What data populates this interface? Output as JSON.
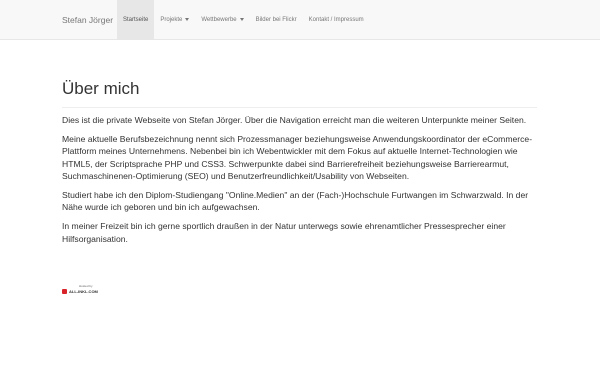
{
  "navbar": {
    "brand": "Stefan Jörger",
    "items": [
      {
        "label": "Startseite",
        "active": true,
        "dropdown": false
      },
      {
        "label": "Projekte",
        "active": false,
        "dropdown": true
      },
      {
        "label": "Wettbewerbe",
        "active": false,
        "dropdown": true
      },
      {
        "label": "Bilder bei Flickr",
        "active": false,
        "dropdown": false
      },
      {
        "label": "Kontakt / Impressum",
        "active": false,
        "dropdown": false
      }
    ]
  },
  "main": {
    "title": "Über mich",
    "paragraphs": [
      "Dies ist die private Webseite von Stefan Jörger. Über die Navigation erreicht man die weiteren Unterpunkte meiner Seiten.",
      "Meine aktuelle Berufsbezeichnung nennt sich Prozessmanager beziehungsweise Anwendungskoordinator der eCommerce-Plattform meines Unternehmens. Nebenbei bin ich Webentwickler mit dem Fokus auf aktuelle Internet-Technologien wie HTML5, der Scriptsprache PHP und CSS3. Schwerpunkte dabei sind Barrierefreiheit beziehungsweise Barrierearmut, Suchmaschinenen-Optimierung (SEO) und Benutzerfreundlichkeit/Usability von Webseiten.",
      "Studiert habe ich den Diplom-Studiengang \"Online.Medien\" an der (Fach-)Hochschule Furtwangen im Schwarzwald. In der Nähe wurde ich geboren und bin ich aufgewachsen.",
      "In meiner Freizeit bin ich gerne sportlich draußen in der Natur unterwegs sowie ehrenamtlicher Pressesprecher einer Hilfsorganisation."
    ]
  },
  "hosting_badge": {
    "caption": "Hosted by",
    "logo_text": "ALL-INKL.COM",
    "accent_color": "#d9232a"
  },
  "colors": {
    "navbar_bg": "#f8f8f8",
    "active_tab_bg": "#e7e7e7",
    "text": "#333333",
    "nav_text": "#777777"
  }
}
